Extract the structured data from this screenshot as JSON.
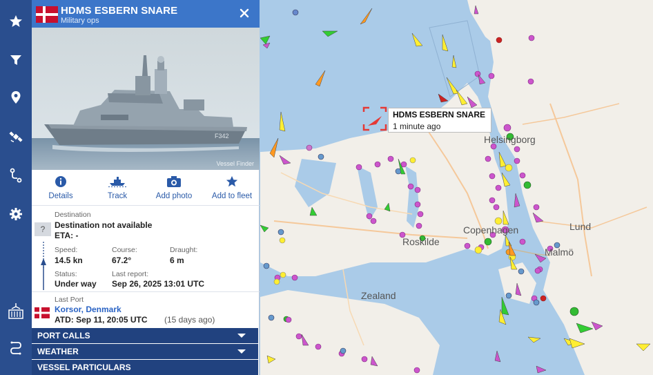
{
  "nav": {
    "items": [
      "star-icon",
      "filter-icon",
      "location-pin-icon",
      "satellite-icon",
      "route-icon",
      "gear-icon",
      "port-icon",
      "track-route-icon"
    ]
  },
  "vessel": {
    "name": "HDMS ESBERN SNARE",
    "type": "Military ops",
    "flag_country": "Denmark"
  },
  "actions": [
    {
      "icon": "info-icon",
      "label": "Details"
    },
    {
      "icon": "ship-track-icon",
      "label": "Track"
    },
    {
      "icon": "camera-icon",
      "label": "Add photo"
    },
    {
      "icon": "star-icon",
      "label": "Add to fleet"
    }
  ],
  "destination": {
    "label": "Destination",
    "value": "Destination not available",
    "eta": "ETA: -",
    "icon_text": "?"
  },
  "stats": {
    "speed_label": "Speed:",
    "speed": "14.5 kn",
    "course_label": "Course:",
    "course": "67.2°",
    "draught_label": "Draught:",
    "draught": "6 m",
    "status_label": "Status:",
    "status": "Under way",
    "last_report_label": "Last report:",
    "last_report": "Sep 26, 2025 13:01 UTC"
  },
  "last_port": {
    "label": "Last Port",
    "name": "Korsor, Denmark",
    "atd": "ATD: Sep 11, 20:05 UTC",
    "ago": "(15 days ago)"
  },
  "sections": [
    "PORT CALLS",
    "WEATHER",
    "VESSEL PARTICULARS"
  ],
  "map": {
    "labels": [
      "Helsingborg",
      "Copenhagen",
      "Roskilde",
      "Malmö",
      "Lund",
      "Zealand"
    ],
    "tooltip": {
      "name": "HDMS ESBERN SNARE",
      "age": "1 minute ago"
    }
  },
  "colors": {
    "rail": "#2a4e8e",
    "header": "#3c76c9",
    "collapse": "#21427f",
    "link": "#2a63c4",
    "sea": "#aacbe8",
    "land": "#f2efe9",
    "highlight": "#e53935"
  },
  "photo": {
    "watermark": "Vessel Finder"
  }
}
